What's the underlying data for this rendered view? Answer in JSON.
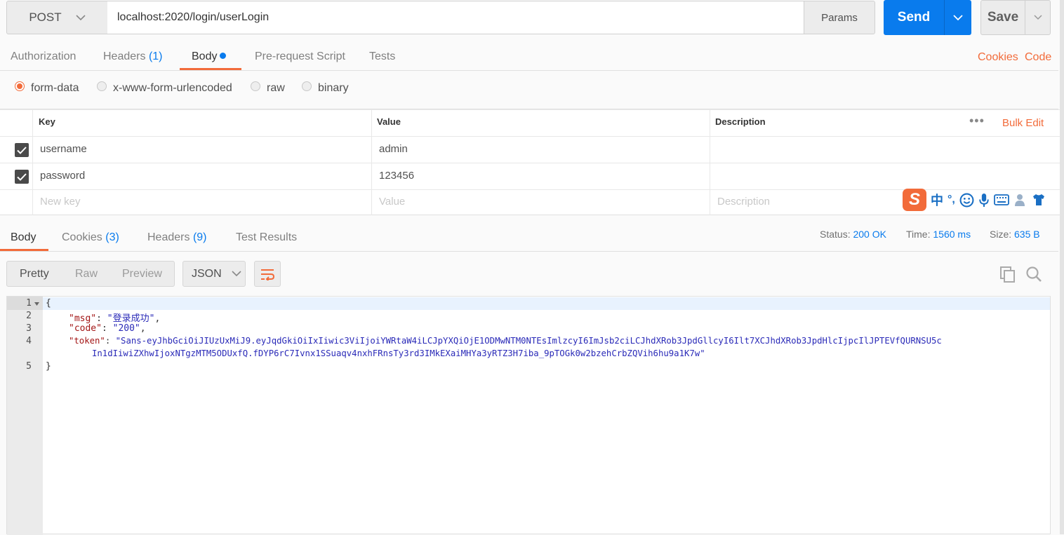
{
  "request": {
    "method": "POST",
    "url": "localhost:2020/login/userLogin",
    "params_label": "Params",
    "send_label": "Send",
    "save_label": "Save"
  },
  "request_tabs": {
    "authorization": "Authorization",
    "headers": "Headers",
    "headers_count": "(1)",
    "body": "Body",
    "prerequest": "Pre-request Script",
    "tests": "Tests",
    "cookies_link": "Cookies",
    "code_link": "Code"
  },
  "body_types": {
    "form_data": "form-data",
    "urlencoded": "x-www-form-urlencoded",
    "raw": "raw",
    "binary": "binary",
    "selected": "form-data"
  },
  "form_table": {
    "headers": {
      "key": "Key",
      "value": "Value",
      "description": "Description"
    },
    "bulk_edit": "Bulk Edit",
    "rows": [
      {
        "checked": true,
        "key": "username",
        "value": "admin",
        "description": ""
      },
      {
        "checked": true,
        "key": "password",
        "value": "123456",
        "description": ""
      }
    ],
    "new_row": {
      "key_placeholder": "New key",
      "value_placeholder": "Value",
      "description_placeholder": "Description"
    }
  },
  "ime_toolbar": {
    "logo": "S",
    "mode": "中",
    "punct": "°,",
    "icons": [
      "emoji-icon",
      "microphone-icon",
      "keyboard-icon",
      "user-icon",
      "shirt-icon"
    ]
  },
  "response_tabs": {
    "body": "Body",
    "cookies": "Cookies",
    "cookies_count": "(3)",
    "headers": "Headers",
    "headers_count": "(9)",
    "test_results": "Test Results"
  },
  "response_status": {
    "status_label": "Status:",
    "status_value": "200 OK",
    "time_label": "Time:",
    "time_value": "1560 ms",
    "size_label": "Size:",
    "size_value": "635 B"
  },
  "response_view": {
    "pretty": "Pretty",
    "raw": "Raw",
    "preview": "Preview",
    "format": "JSON"
  },
  "response_body": {
    "line_numbers": [
      "1",
      "2",
      "3",
      "4",
      "5"
    ],
    "open_brace": "{",
    "close_brace": "}",
    "msg_key": "\"msg\"",
    "msg_value": "\"登录成功\"",
    "code_key": "\"code\"",
    "code_value": "\"200\"",
    "token_key": "\"token\"",
    "token_value_line1": "\"Sans-eyJhbGciOiJIUzUxMiJ9.eyJqdGkiOiIxIiwic3ViIjoiYWRtaW4iLCJpYXQiOjE1ODMwNTM0NTEsImlzcyI6ImJsb2ciLCJhdXRob3JpdGllcyI6Ilt7XCJhdXRob3JpdHlcIjpcIlJPTEVfQURNSU5c",
    "token_value_line2": "In1dIiwiZXhwIjoxNTgzMTM5ODUxfQ.fDYP6rC7Ivnx1SSuaqv4nxhFRnsTy3rd3IMkEXaiMHYa3yRTZ3H7iba_9pTOGk0w2bzehCrbZQVih6hu9a1K7w\""
  },
  "colors": {
    "accent_orange": "#f26b3a",
    "accent_blue": "#097bed"
  }
}
